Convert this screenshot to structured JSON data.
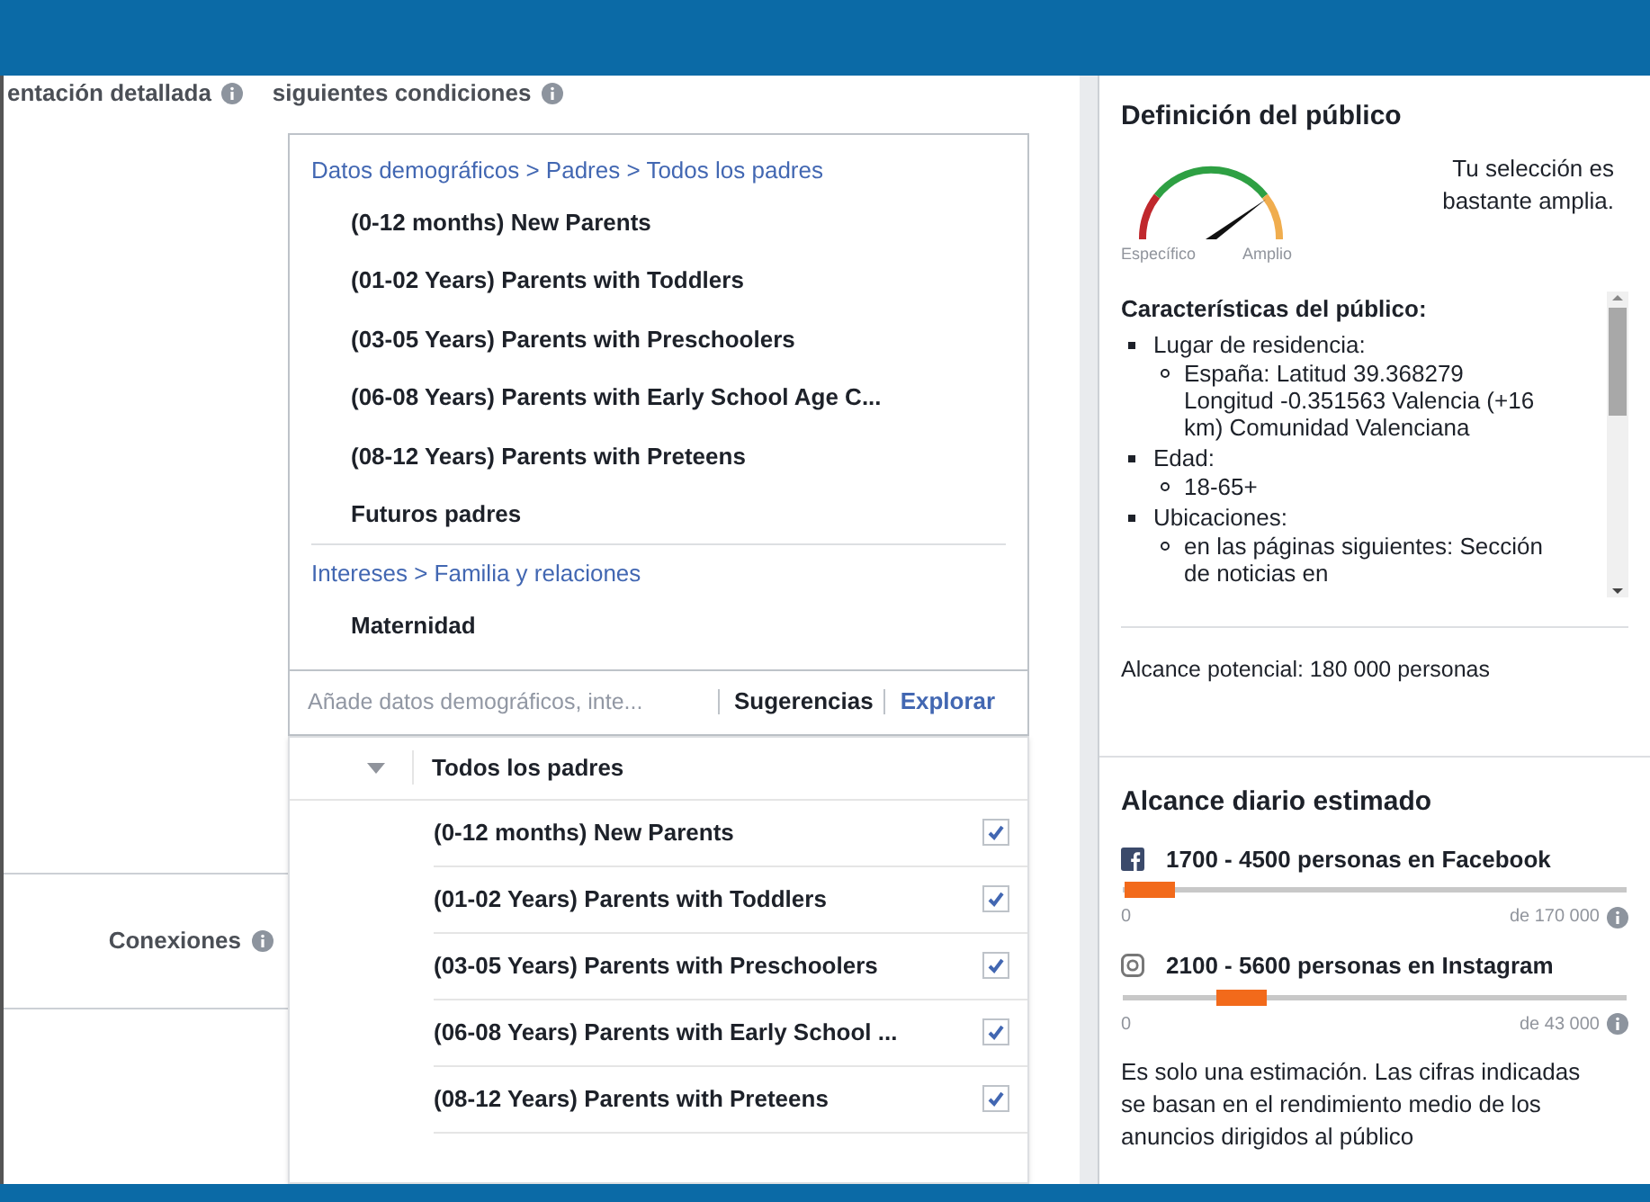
{
  "left": {
    "section_label": "entación detallada",
    "conditions_label": "siguientes condiciones",
    "connections_label": "Conexiones"
  },
  "selection": {
    "groups": [
      {
        "path": "Datos demográficos > Padres > Todos los padres",
        "items": [
          "(0-12 months) New Parents",
          "(01-02 Years) Parents with Toddlers",
          "(03-05 Years) Parents with Preschoolers",
          "(06-08 Years) Parents with Early School Age C...",
          "(08-12 Years) Parents with Preteens",
          "Futuros padres"
        ]
      },
      {
        "path": "Intereses > Familia y relaciones",
        "items": [
          "Maternidad"
        ]
      }
    ],
    "placeholder": "Añade datos demográficos, inte...",
    "tabs": [
      {
        "label": "Sugerencias",
        "selected": false
      },
      {
        "label": "Explorar",
        "selected": true
      }
    ]
  },
  "explore": {
    "header": "Todos los padres",
    "expanded": true,
    "rows": [
      {
        "label": "(0-12 months) New Parents",
        "checked": true
      },
      {
        "label": "(01-02 Years) Parents with Toddlers",
        "checked": true
      },
      {
        "label": "(03-05 Years) Parents with Preschoolers",
        "checked": true
      },
      {
        "label": "(06-08 Years) Parents with Early School ...",
        "checked": true
      },
      {
        "label": "(08-12 Years) Parents with Preteens",
        "checked": true
      }
    ]
  },
  "audience": {
    "title": "Definición del público",
    "gauge_left": "Específico",
    "gauge_right": "Amplio",
    "verdict": "Tu selección es bastante amplia.",
    "traits_title": "Características del público:",
    "traits": [
      {
        "label": "Lugar de residencia:",
        "children": [
          "España: Latitud 39.368279 Longitud -0.351563 Valencia (+16 km) Comunidad Valenciana"
        ]
      },
      {
        "label": "Edad:",
        "children": [
          "18-65+"
        ]
      },
      {
        "label": "Ubicaciones:",
        "children": [
          "en las páginas siguientes: Sección de noticias en"
        ]
      }
    ],
    "potential": "Alcance potencial: 180 000 personas"
  },
  "daily": {
    "title": "Alcance diario estimado",
    "platforms": [
      {
        "kind": "facebook",
        "label": "1700 - 4500 personas en Facebook",
        "level": 0.055,
        "min": "0",
        "max": "de 170 000"
      },
      {
        "kind": "instagram",
        "label": "2100 - 5600 personas en Instagram",
        "level": 0.235,
        "min": "0",
        "max": "de 43 000"
      }
    ],
    "note": "Es solo una estimación. Las cifras indicadas se basan en el rendimiento medio de los anuncios dirigidos al público"
  }
}
